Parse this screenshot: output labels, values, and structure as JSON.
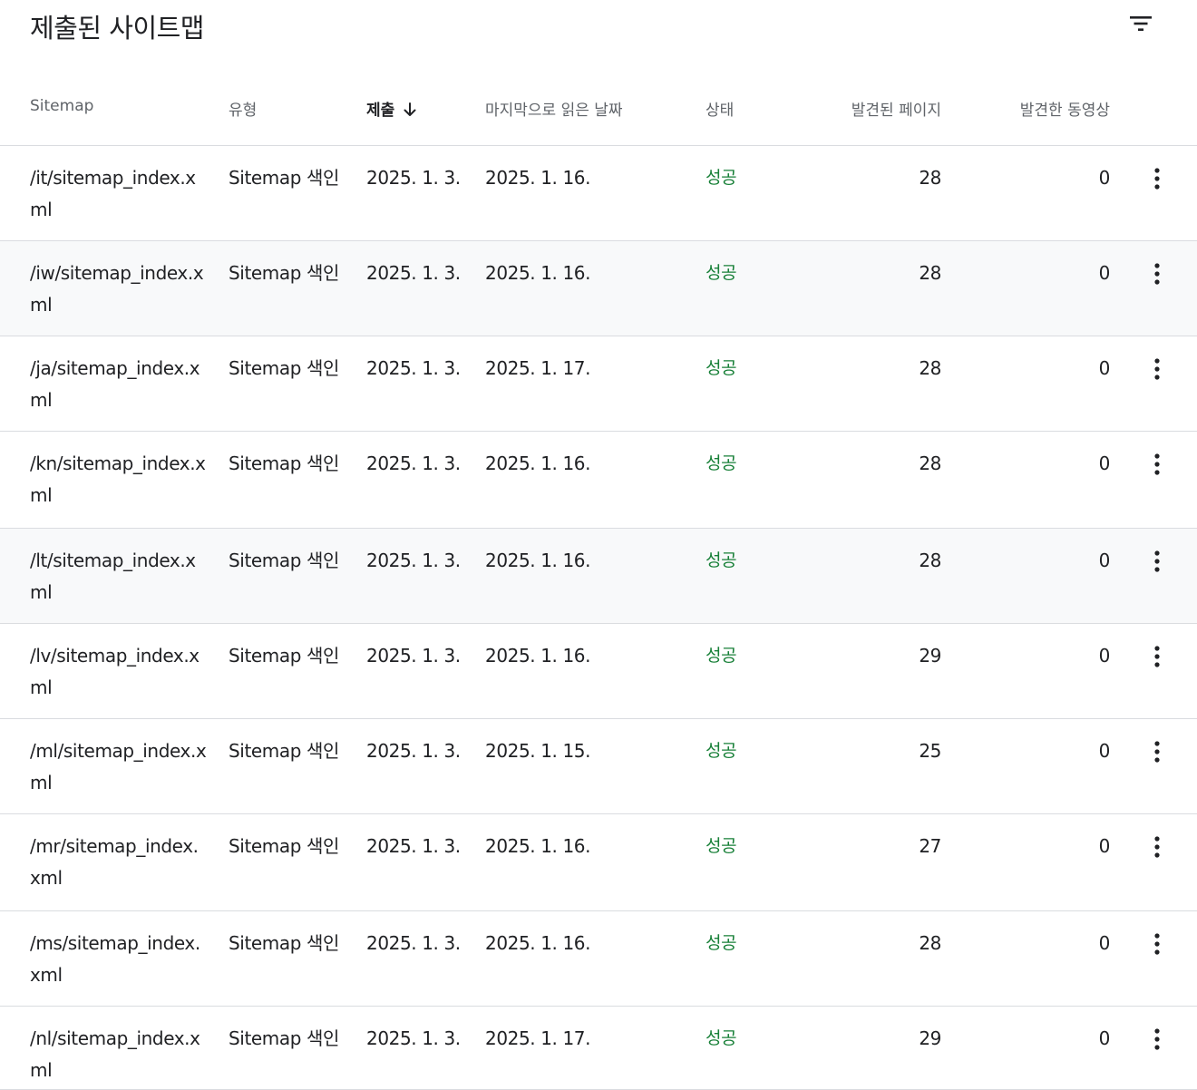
{
  "header": {
    "title": "제출된 사이트맵",
    "filter_icon": "filter-icon"
  },
  "table": {
    "columns": {
      "sitemap": "Sitemap",
      "type": "유형",
      "submitted": "제출",
      "last_read": "마지막으로 읽은 날짜",
      "status": "상태",
      "discovered_pages": "발견된 페이지",
      "discovered_videos": "발견한 동영상"
    },
    "sorted_column": "submitted",
    "sort_direction": "descending",
    "sort_icon": "arrow-down-icon",
    "row_action_icon": "more-vert-icon",
    "status_color": "#188038",
    "rows": [
      {
        "sitemap": "/it/sitemap_index.xml",
        "type": "Sitemap 색인",
        "submitted": "2025. 1. 3.",
        "last_read": "2025. 1. 16.",
        "status": "성공",
        "pages": "28",
        "videos": "0"
      },
      {
        "sitemap": "/iw/sitemap_index.xml",
        "type": "Sitemap 색인",
        "submitted": "2025. 1. 3.",
        "last_read": "2025. 1. 16.",
        "status": "성공",
        "pages": "28",
        "videos": "0"
      },
      {
        "sitemap": "/ja/sitemap_index.xml",
        "type": "Sitemap 색인",
        "submitted": "2025. 1. 3.",
        "last_read": "2025. 1. 17.",
        "status": "성공",
        "pages": "28",
        "videos": "0"
      },
      {
        "sitemap": "/kn/sitemap_index.xml",
        "type": "Sitemap 색인",
        "submitted": "2025. 1. 3.",
        "last_read": "2025. 1. 16.",
        "status": "성공",
        "pages": "28",
        "videos": "0"
      },
      {
        "sitemap": "/lt/sitemap_index.xml",
        "type": "Sitemap 색인",
        "submitted": "2025. 1. 3.",
        "last_read": "2025. 1. 16.",
        "status": "성공",
        "pages": "28",
        "videos": "0"
      },
      {
        "sitemap": "/lv/sitemap_index.xml",
        "type": "Sitemap 색인",
        "submitted": "2025. 1. 3.",
        "last_read": "2025. 1. 16.",
        "status": "성공",
        "pages": "29",
        "videos": "0"
      },
      {
        "sitemap": "/ml/sitemap_index.xml",
        "type": "Sitemap 색인",
        "submitted": "2025. 1. 3.",
        "last_read": "2025. 1. 15.",
        "status": "성공",
        "pages": "25",
        "videos": "0"
      },
      {
        "sitemap": "/mr/sitemap_index.xml",
        "type": "Sitemap 색인",
        "submitted": "2025. 1. 3.",
        "last_read": "2025. 1. 16.",
        "status": "성공",
        "pages": "27",
        "videos": "0"
      },
      {
        "sitemap": "/ms/sitemap_index.xml",
        "type": "Sitemap 색인",
        "submitted": "2025. 1. 3.",
        "last_read": "2025. 1. 16.",
        "status": "성공",
        "pages": "28",
        "videos": "0"
      },
      {
        "sitemap": "/nl/sitemap_index.xml",
        "type": "Sitemap 색인",
        "submitted": "2025. 1. 3.",
        "last_read": "2025. 1. 17.",
        "status": "성공",
        "pages": "29",
        "videos": "0"
      }
    ]
  }
}
